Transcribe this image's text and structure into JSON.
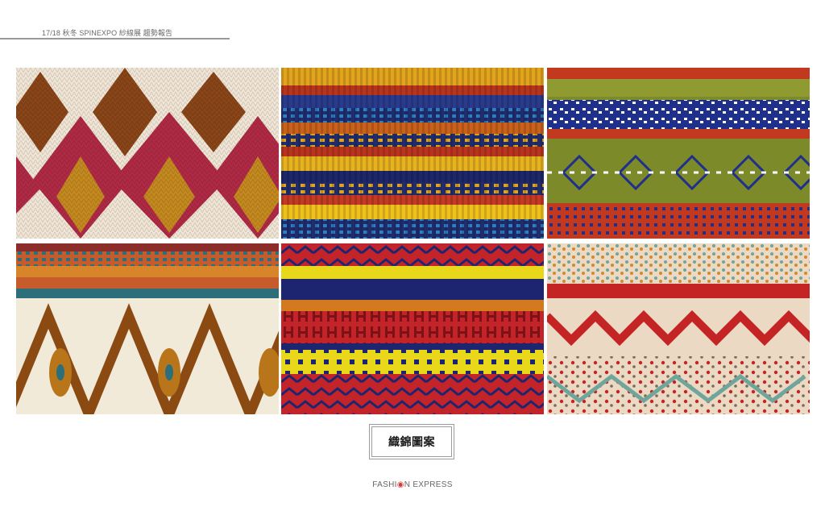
{
  "header": {
    "title": "17/18 秋冬 SPINEXPO 紗線展  趨勢報告"
  },
  "caption": {
    "label": "織錦圖案"
  },
  "footer": {
    "brand_pre": "FASHI",
    "brand_mark": "◉",
    "brand_post": "N EXPRESS"
  },
  "images": [
    {
      "name": "argyle-diamond-knit-photo",
      "colors": [
        "#f1e6d6",
        "#8a4518",
        "#b02a45",
        "#c58a1f"
      ]
    },
    {
      "name": "multicolor-stripe-knit-photo",
      "colors": [
        "#1f2d6e",
        "#e1a41c",
        "#b8341d",
        "#2f7fc4"
      ]
    },
    {
      "name": "green-fair-isle-knit-photo",
      "colors": [
        "#7d8a2a",
        "#1f2f8c",
        "#ffffff",
        "#c2391f"
      ]
    },
    {
      "name": "brown-ikat-knit-photo",
      "colors": [
        "#f2ead8",
        "#8a4a12",
        "#c65b2c",
        "#2c6f7a"
      ]
    },
    {
      "name": "red-navy-jacquard-knit-photo",
      "colors": [
        "#c2242a",
        "#1d2470",
        "#e9d81a",
        "#d37a1e"
      ]
    },
    {
      "name": "cream-red-boucle-knit-photo",
      "colors": [
        "#ecd9c4",
        "#c52424",
        "#6fa59a",
        "#d18a2e"
      ]
    }
  ]
}
